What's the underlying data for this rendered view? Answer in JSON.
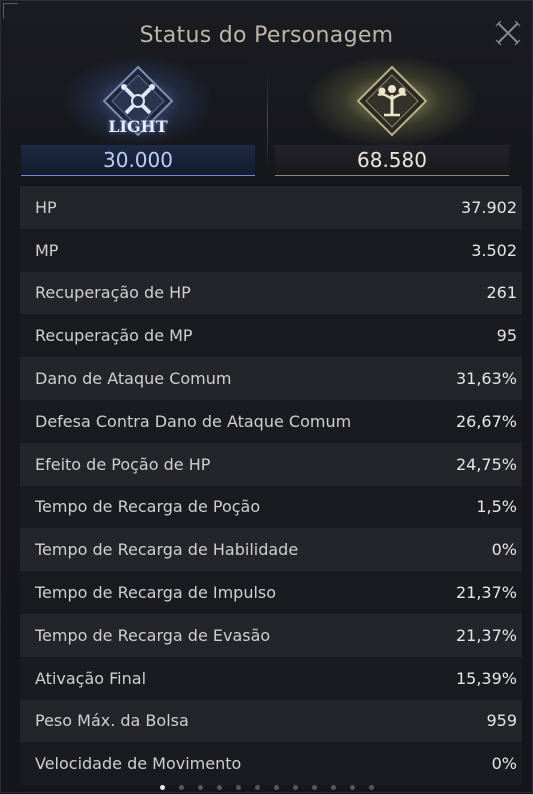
{
  "window": {
    "title": "Status do Personagem"
  },
  "emblems": {
    "light": {
      "label": "LIGHT",
      "value": "30.000",
      "icon": "light-crest-icon",
      "color": "#b9cff5"
    },
    "tree": {
      "value": "68.580",
      "icon": "tree-crest-icon",
      "color": "#ece7d8"
    }
  },
  "stats": [
    {
      "label": "HP",
      "value": "37.902"
    },
    {
      "label": "MP",
      "value": "3.502"
    },
    {
      "label": "Recuperação de HP",
      "value": "261"
    },
    {
      "label": "Recuperação de MP",
      "value": "95"
    },
    {
      "label": "Dano de Ataque Comum",
      "value": "31,63%"
    },
    {
      "label": "Defesa Contra Dano de Ataque Comum",
      "value": "26,67%"
    },
    {
      "label": "Efeito de Poção de HP",
      "value": "24,75%"
    },
    {
      "label": "Tempo de Recarga de Poção",
      "value": "1,5%"
    },
    {
      "label": "Tempo de Recarga de Habilidade",
      "value": "0%"
    },
    {
      "label": "Tempo de Recarga de Impulso",
      "value": "21,37%"
    },
    {
      "label": "Tempo de Recarga de Evasão",
      "value": "21,37%"
    },
    {
      "label": "Ativação Final",
      "value": "15,39%"
    },
    {
      "label": "Peso Máx. da Bolsa",
      "value": "959"
    },
    {
      "label": "Velocidade de Movimento",
      "value": "0%"
    }
  ],
  "pager": {
    "total": 12,
    "active": 0
  }
}
